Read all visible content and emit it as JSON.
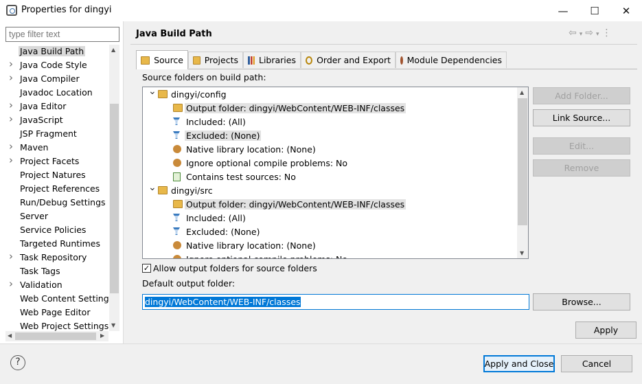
{
  "window": {
    "title": "Properties for dingyi",
    "minimize": "—",
    "maximize": "☐",
    "close": "✕"
  },
  "sidebar": {
    "filter_placeholder": "type filter text",
    "items": [
      {
        "label": "Java Build Path",
        "expandable": false,
        "selected": true
      },
      {
        "label": "Java Code Style",
        "expandable": true
      },
      {
        "label": "Java Compiler",
        "expandable": true
      },
      {
        "label": "Javadoc Location",
        "expandable": false
      },
      {
        "label": "Java Editor",
        "expandable": true
      },
      {
        "label": "JavaScript",
        "expandable": true
      },
      {
        "label": "JSP Fragment",
        "expandable": false
      },
      {
        "label": "Maven",
        "expandable": true
      },
      {
        "label": "Project Facets",
        "expandable": true
      },
      {
        "label": "Project Natures",
        "expandable": false
      },
      {
        "label": "Project References",
        "expandable": false
      },
      {
        "label": "Run/Debug Settings",
        "expandable": false
      },
      {
        "label": "Server",
        "expandable": false
      },
      {
        "label": "Service Policies",
        "expandable": false
      },
      {
        "label": "Targeted Runtimes",
        "expandable": false
      },
      {
        "label": "Task Repository",
        "expandable": true
      },
      {
        "label": "Task Tags",
        "expandable": false
      },
      {
        "label": "Validation",
        "expandable": true
      },
      {
        "label": "Web Content Settings",
        "expandable": false
      },
      {
        "label": "Web Page Editor",
        "expandable": false
      },
      {
        "label": "Web Project Settings",
        "expandable": false
      }
    ]
  },
  "header": {
    "title": "Java Build Path"
  },
  "tabs": [
    {
      "label": "Source",
      "icon": "source-folder-icon",
      "active": true
    },
    {
      "label": "Projects",
      "icon": "projects-icon"
    },
    {
      "label": "Libraries",
      "icon": "libraries-icon"
    },
    {
      "label": "Order and Export",
      "icon": "order-export-icon"
    },
    {
      "label": "Module Dependencies",
      "icon": "module-icon"
    }
  ],
  "source": {
    "label": "Source folders on build path:",
    "tree": [
      {
        "text": "dingyi/config",
        "level": 0,
        "icon": "package-folder-icon",
        "expanded": true
      },
      {
        "text": "Output folder: dingyi/WebContent/WEB-INF/classes",
        "level": 1,
        "icon": "output-folder-icon",
        "highlight": true
      },
      {
        "text": "Included: (All)",
        "level": 1,
        "icon": "filter-icon"
      },
      {
        "text": "Excluded: (None)",
        "level": 1,
        "icon": "filter-icon",
        "highlight": true
      },
      {
        "text": "Native library location: (None)",
        "level": 1,
        "icon": "native-library-icon"
      },
      {
        "text": "Ignore optional compile problems: No",
        "level": 1,
        "icon": "ignore-problems-icon"
      },
      {
        "text": "Contains test sources: No",
        "level": 1,
        "icon": "test-sources-icon"
      },
      {
        "text": "dingyi/src",
        "level": 0,
        "icon": "package-folder-icon",
        "expanded": true
      },
      {
        "text": "Output folder: dingyi/WebContent/WEB-INF/classes",
        "level": 1,
        "icon": "output-folder-icon",
        "highlight": true
      },
      {
        "text": "Included: (All)",
        "level": 1,
        "icon": "filter-icon"
      },
      {
        "text": "Excluded: (None)",
        "level": 1,
        "icon": "filter-icon"
      },
      {
        "text": "Native library location: (None)",
        "level": 1,
        "icon": "native-library-icon"
      },
      {
        "text": "Ignore optional compile problems: No",
        "level": 1,
        "icon": "ignore-problems-icon"
      }
    ],
    "buttons": {
      "add_folder": "Add Folder...",
      "link_source": "Link Source...",
      "edit": "Edit...",
      "remove": "Remove"
    },
    "allow_output_label": "Allow output folders for source folders",
    "allow_output_checked": true,
    "default_output_label": "Default output folder:",
    "default_output_value": "dingyi/WebContent/WEB-INF/classes",
    "browse": "Browse..."
  },
  "footer": {
    "apply": "Apply",
    "apply_close": "Apply and Close",
    "cancel": "Cancel",
    "help": "?"
  }
}
